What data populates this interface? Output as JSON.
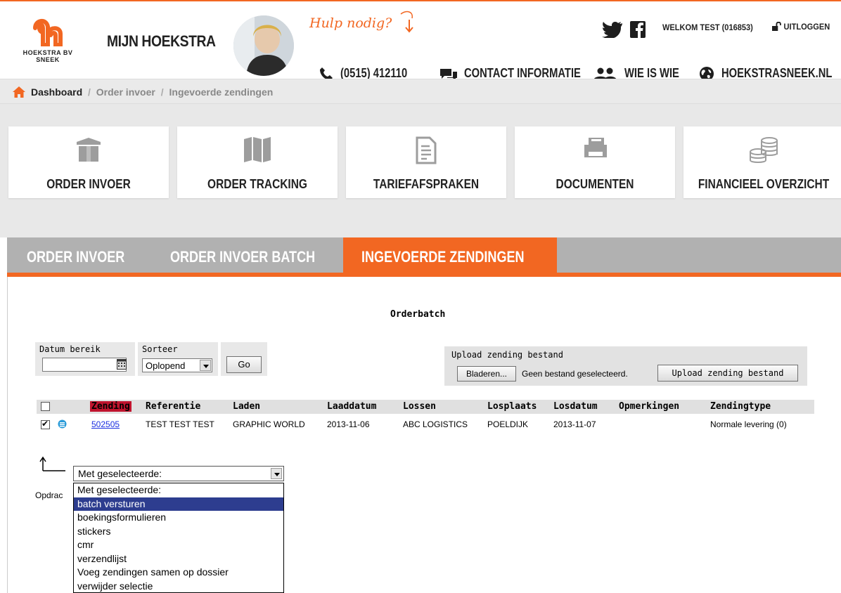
{
  "header": {
    "brand_line1": "HOEKSTRA BV",
    "brand_line2": "SNEEK",
    "site_title": "MIJN HOEKSTRA",
    "help_text": "Hulp nodig?",
    "welcome": "WELKOM TEST (016853)",
    "logout": "UITLOGGEN",
    "phone": "(0515) 412110",
    "contact": "CONTACT INFORMATIE",
    "who": "WIE IS WIE",
    "website": "HOEKSTRASNEEK.NL"
  },
  "breadcrumb": {
    "items": [
      "Dashboard",
      "Order invoer",
      "Ingevoerde zendingen"
    ],
    "separator": "/"
  },
  "tiles": [
    {
      "label": "ORDER INVOER",
      "icon": "box-icon"
    },
    {
      "label": "ORDER TRACKING",
      "icon": "map-icon"
    },
    {
      "label": "TARIEFAFSPRAKEN",
      "icon": "document-icon"
    },
    {
      "label": "DOCUMENTEN",
      "icon": "printer-icon"
    },
    {
      "label": "FINANCIEEL OVERZICHT",
      "icon": "coins-icon"
    }
  ],
  "tabs": [
    {
      "label": "ORDER INVOER",
      "active": false
    },
    {
      "label": "ORDER INVOER BATCH",
      "active": false
    },
    {
      "label": "INGEVOERDE ZENDINGEN",
      "active": true
    }
  ],
  "main": {
    "heading": "Orderbatch",
    "filter": {
      "date_label": "Datum bereik",
      "date_value": "",
      "sort_label": "Sorteer",
      "sort_value": "Oplopend",
      "go_label": "Go"
    },
    "upload": {
      "label": "Upload zending bestand",
      "browse_label": "Bladeren...",
      "no_file": "Geen bestand geselecteerd.",
      "button_label": "Upload zending bestand"
    },
    "table": {
      "columns": [
        "Zending",
        "Referentie",
        "Laden",
        "Laaddatum",
        "Lossen",
        "Losplaats",
        "Losdatum",
        "Opmerkingen",
        "Zendingtype"
      ],
      "rows": [
        {
          "checked": true,
          "zending": "502505",
          "referentie": "TEST TEST TEST",
          "laden": "GRAPHIC WORLD",
          "laaddatum": "2013-11-06",
          "lossen": "ABC LOGISTICS",
          "losplaats": "POELDIJK",
          "losdatum": "2013-11-07",
          "opmerkingen": "",
          "zendingtype": "Normale levering (0)"
        }
      ]
    },
    "actions": {
      "select_value": "Met geselecteerde:",
      "partial_label": "Opdrac",
      "options": [
        "Met geselecteerde:",
        "batch versturen",
        "boekingsformulieren",
        "stickers",
        "cmr",
        "verzendlijst",
        "Voeg zendingen samen op dossier",
        "verwijder selectie"
      ],
      "highlighted_index": 1
    }
  },
  "colors": {
    "accent": "#f26722",
    "tab_bar": "#b1b1b1",
    "sorted_header": "#c0142e",
    "dropdown_highlight": "#2d3d8f"
  }
}
